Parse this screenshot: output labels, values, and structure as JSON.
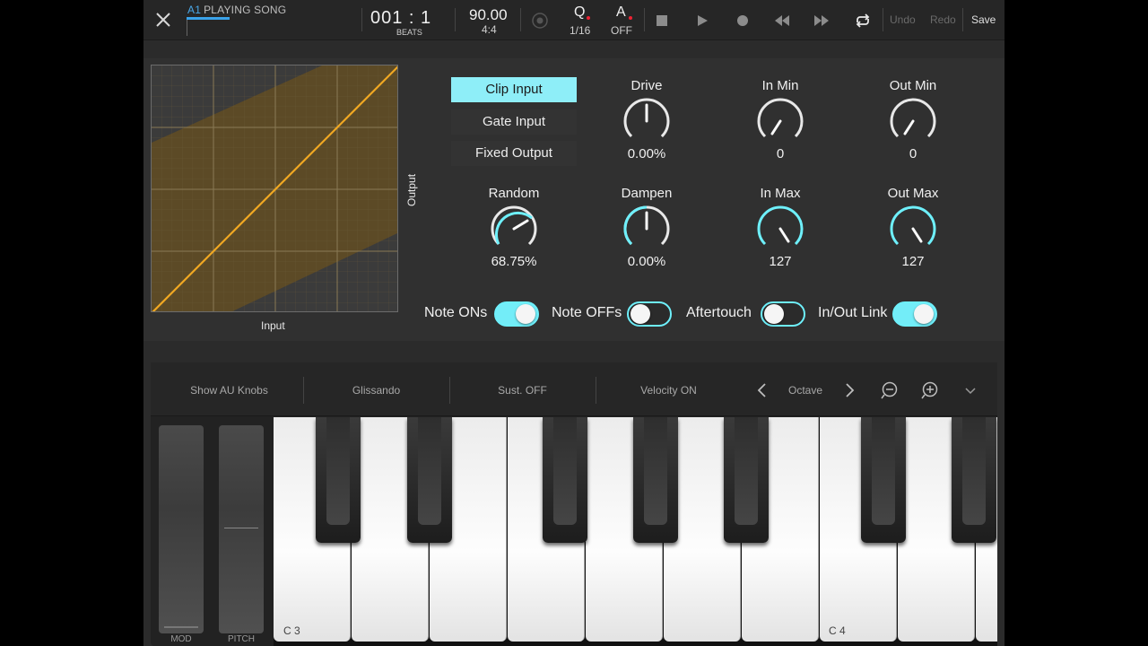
{
  "topbar": {
    "track": "A1",
    "song_status": "PLAYING SONG",
    "position": "001 : 1",
    "position_unit": "BEATS",
    "tempo": "90.00",
    "time_signature": "4:4",
    "quantize_label": "Q",
    "quantize_value": "1/16",
    "automation_label": "A",
    "automation_value": "OFF",
    "undo": "Undo",
    "redo": "Redo",
    "save": "Save"
  },
  "graph": {
    "x_label": "Input",
    "y_label": "Output"
  },
  "modes": [
    {
      "label": "Clip Input",
      "selected": true
    },
    {
      "label": "Gate Input",
      "selected": false
    },
    {
      "label": "Fixed Output",
      "selected": false
    }
  ],
  "knobs": {
    "drive": {
      "label": "Drive",
      "value": "0.00%"
    },
    "in_min": {
      "label": "In Min",
      "value": "0"
    },
    "out_min": {
      "label": "Out Min",
      "value": "0"
    },
    "random": {
      "label": "Random",
      "value": "68.75%"
    },
    "dampen": {
      "label": "Dampen",
      "value": "0.00%"
    },
    "in_max": {
      "label": "In Max",
      "value": "127"
    },
    "out_max": {
      "label": "Out Max",
      "value": "127"
    }
  },
  "toggles": {
    "note_ons": {
      "label": "Note ONs",
      "on": true
    },
    "note_offs": {
      "label": "Note OFFs",
      "on": false
    },
    "aftertouch": {
      "label": "Aftertouch",
      "on": false
    },
    "inout_link": {
      "label": "In/Out Link",
      "on": true
    }
  },
  "keyboard": {
    "show_au_knobs": "Show AU Knobs",
    "glissando": "Glissando",
    "sustain": "Sust. OFF",
    "velocity": "Velocity ON",
    "octave": "Octave",
    "mod_label": "MOD",
    "pitch_label": "PITCH",
    "key_c3": "C 3",
    "key_c4": "C 4"
  },
  "colors": {
    "accent": "#73edf8",
    "curve": "#f0a823",
    "track_blue": "#3aa3ea"
  }
}
